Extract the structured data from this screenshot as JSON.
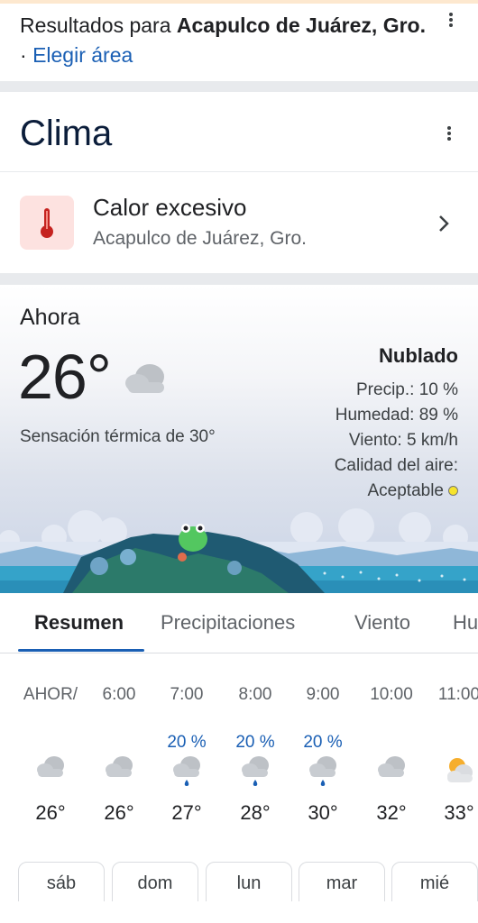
{
  "results": {
    "prefix": "Resultados para ",
    "location": "Acapulco de Juárez, Gro.",
    "separator": " · ",
    "link": "Elegir área"
  },
  "clima": {
    "title": "Clima"
  },
  "alert": {
    "title": "Calor excesivo",
    "subtitle": "Acapulco de Juárez, Gro.",
    "icon": "thermometer-icon",
    "icon_bg": "#fde2e0",
    "icon_color": "#c5221f"
  },
  "now": {
    "label": "Ahora",
    "temperature": "26°",
    "feels_like": "Sensación térmica de 30°",
    "condition": "Nublado",
    "precip": "Precip.: 10 %",
    "humidity": "Humedad: 89 %",
    "wind": "Viento: 5 km/h",
    "air_quality_label": "Calidad del aire:",
    "air_quality_value": "Aceptable",
    "air_quality_color": "#f6e32c"
  },
  "tabs": [
    "Resumen",
    "Precipitaciones",
    "Viento",
    "Hu"
  ],
  "hourly": [
    {
      "time": "AHOR/",
      "precip": "",
      "icon": "cloud-icon",
      "temp": "26°"
    },
    {
      "time": "6:00",
      "precip": "",
      "icon": "cloud-icon",
      "temp": "26°"
    },
    {
      "time": "7:00",
      "precip": "20 %",
      "icon": "rain-icon",
      "temp": "27°"
    },
    {
      "time": "8:00",
      "precip": "20 %",
      "icon": "rain-icon",
      "temp": "28°"
    },
    {
      "time": "9:00",
      "precip": "20 %",
      "icon": "rain-icon",
      "temp": "30°"
    },
    {
      "time": "10:00",
      "precip": "",
      "icon": "cloud-icon",
      "temp": "32°"
    },
    {
      "time": "11:00",
      "precip": "",
      "icon": "partly-sunny-icon",
      "temp": "33°"
    }
  ],
  "days": [
    "sáb",
    "dom",
    "lun",
    "mar",
    "mié"
  ],
  "colors": {
    "link": "#1a5fb4",
    "accent": "#1a5fb4",
    "rain_drop": "#1a5fb4"
  }
}
